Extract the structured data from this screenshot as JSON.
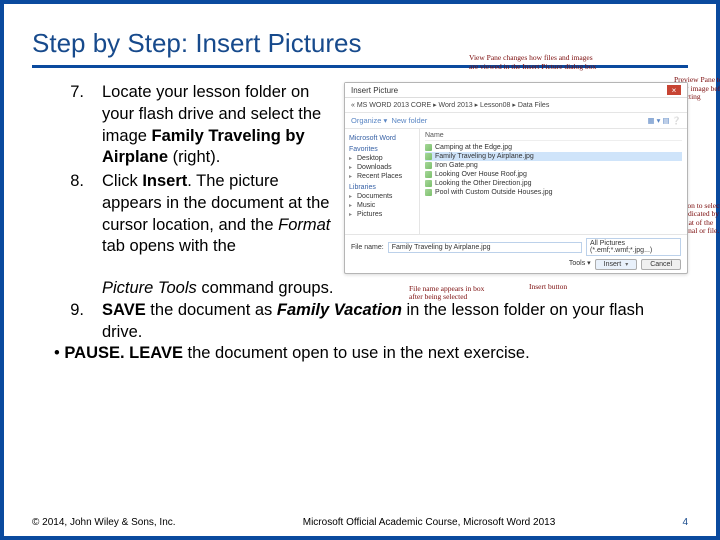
{
  "title": "Step by Step: Insert Pictures",
  "steps": {
    "s7": {
      "num": "7.",
      "text_a": "Locate your lesson folder on your flash drive and select the image ",
      "bold_a": "Family Traveling by Airplane",
      "text_b": " (right)."
    },
    "s8": {
      "num": "8.",
      "text_a": "Click ",
      "bold_a": "Insert",
      "text_b": ". The picture appears in the document at the cursor location, and the ",
      "italic_a": "Format",
      "text_c": " tab opens with the ",
      "italic_b": "Picture Tools",
      "text_d": " command groups."
    },
    "s9": {
      "num": "9.",
      "bold_a": "SAVE",
      "text_a": " the document as ",
      "bolditalic_a": "Family Vacation",
      "text_b": " in the lesson folder on your flash drive."
    }
  },
  "pause": {
    "bold_a": "PAUSE. LEAVE",
    "text_a": " the document open to use in the next exercise."
  },
  "dialog": {
    "title": "Insert Picture",
    "breadcrumb": "« MS WORD 2013 CORE ▸ Word 2013 ▸ Lesson08 ▸ Data Files",
    "organize": "Organize ▾",
    "newfolder": "New folder",
    "nav": {
      "word": "Microsoft Word",
      "fav": "Favorites",
      "desktop": "Desktop",
      "downloads": "Downloads",
      "recent": "Recent Places",
      "lib": "Libraries",
      "docs": "Documents",
      "music": "Music",
      "pics": "Pictures"
    },
    "colhead": "Name",
    "files": {
      "f1": "Camping at the Edge.jpg",
      "f2": "Family Traveling by Airplane.jpg",
      "f3": "Iron Gate.png",
      "f4": "Looking Over House Roof.jpg",
      "f5": "Looking the Other Direction.jpg",
      "f6": "Pool with Custom Outside Houses.jpg"
    },
    "filename_label": "File name:",
    "filename_value": "Family Traveling by Airplane.jpg",
    "filetype": "All Pictures (*.emf;*.wmf;*.jpg...)",
    "tools": "Tools ▾",
    "insert_btn": "Insert",
    "cancel_btn": "Cancel"
  },
  "callouts": {
    "top": "View Pane changes how files and images are viewed in the Insert Picture dialog box",
    "preview": "Preview Pane to view image before selecting",
    "option": "Option to select an as indicated by the format of the original or file.",
    "filename": "File name appears in box after being selected",
    "insert": "Insert button"
  },
  "footer": {
    "copyright": "© 2014, John Wiley & Sons, Inc.",
    "course": "Microsoft Official Academic Course, Microsoft Word 2013",
    "page": "4"
  }
}
